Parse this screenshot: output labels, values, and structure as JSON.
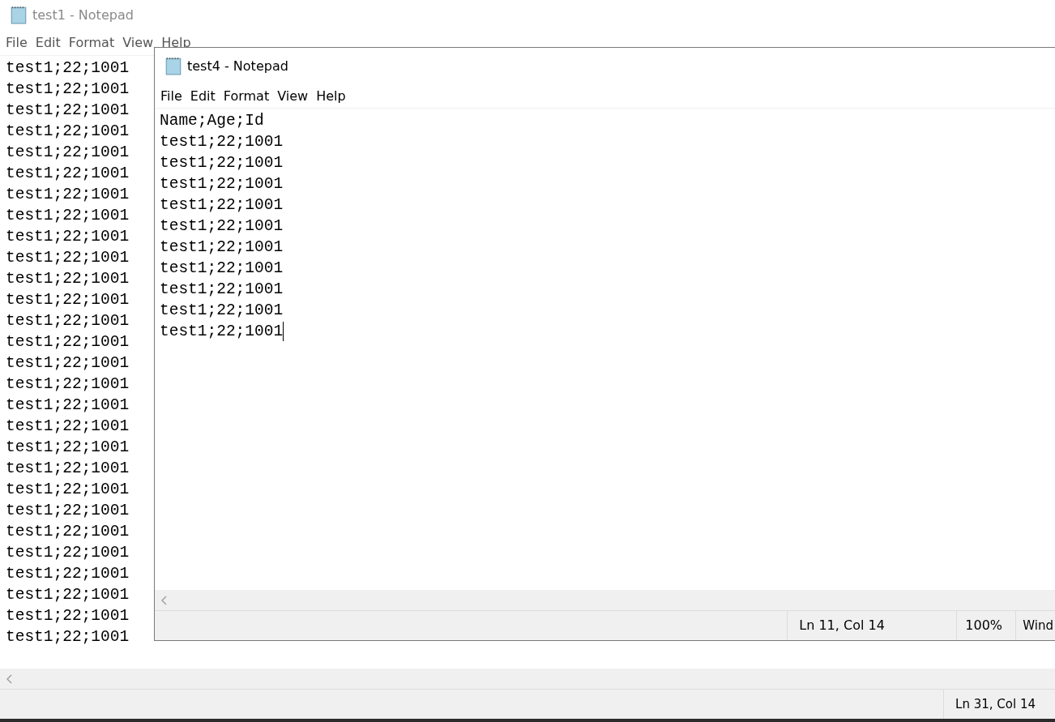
{
  "back_window": {
    "title": "test1 - Notepad",
    "active": false,
    "menu": [
      "File",
      "Edit",
      "Format",
      "View",
      "Help"
    ],
    "lines": [
      "test1;22;1001",
      "test1;22;1001",
      "test1;22;1001",
      "test1;22;1001",
      "test1;22;1001",
      "test1;22;1001",
      "test1;22;1001",
      "test1;22;1001",
      "test1;22;1001",
      "test1;22;1001",
      "test1;22;1001",
      "test1;22;1001",
      "test1;22;1001",
      "test1;22;1001",
      "test1;22;1001",
      "test1;22;1001",
      "test1;22;1001",
      "test1;22;1001",
      "test1;22;1001",
      "test1;22;1001",
      "test1;22;1001",
      "test1;22;1001",
      "test1;22;1001",
      "test1;22;1001",
      "test1;22;1001",
      "test1;22;1001",
      "test1;22;1001",
      "test1;22;1001"
    ],
    "status": [
      "Ln 31, Col 14"
    ]
  },
  "front_window": {
    "title": "test4 - Notepad",
    "active": true,
    "menu": [
      "File",
      "Edit",
      "Format",
      "View",
      "Help"
    ],
    "lines": [
      "Name;Age;Id",
      "test1;22;1001",
      "test1;22;1001",
      "test1;22;1001",
      "test1;22;1001",
      "test1;22;1001",
      "test1;22;1001",
      "test1;22;1001",
      "test1;22;1001",
      "test1;22;1001",
      "test1;22;1001"
    ],
    "cursor_at_end": true,
    "status": [
      "Ln 11, Col 14",
      "100%",
      "Wind"
    ]
  }
}
